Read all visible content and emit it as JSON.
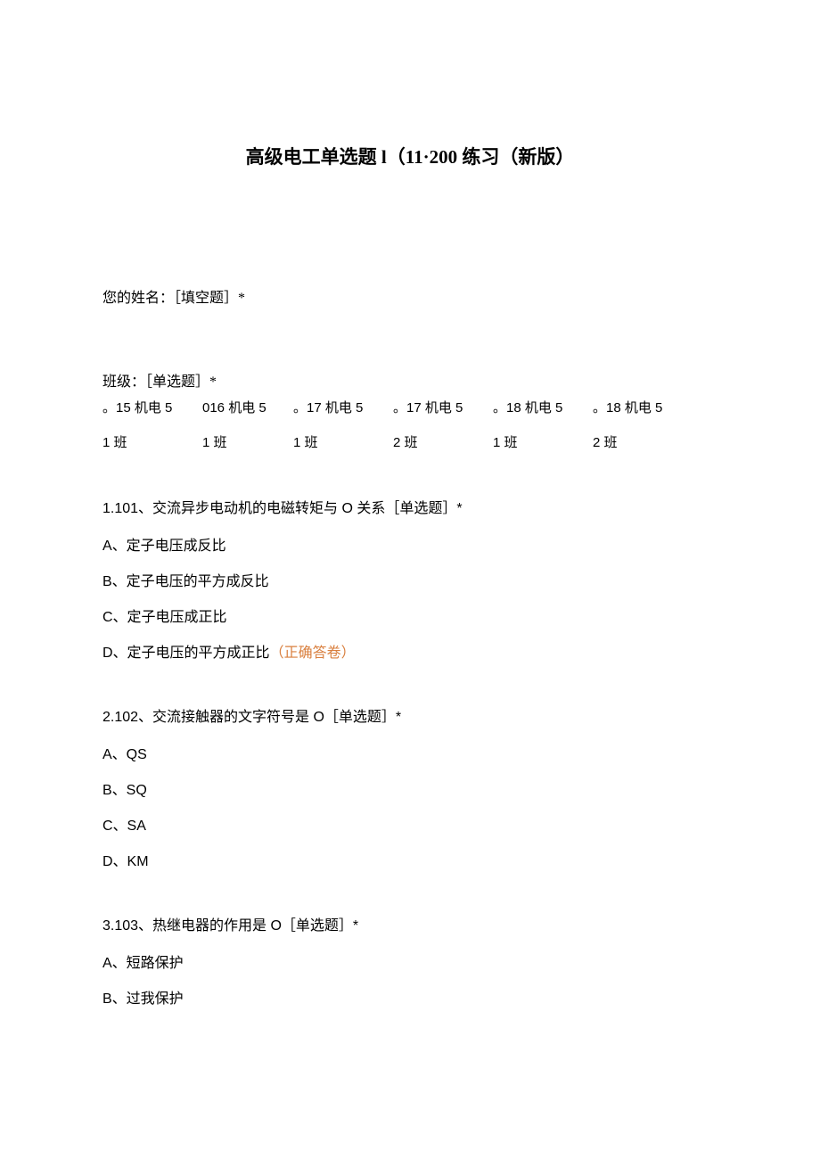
{
  "title": "高级电工单选题 l（11·200 练习（新版）",
  "name_label": "您的姓名：［填空题］*",
  "class_label": "班级：［单选题］*",
  "class_options": {
    "row1": [
      "。15 机电 5",
      "016 机电 5",
      "。17 机电 5",
      "。17 机电 5",
      "。18 机电 5",
      "。18 机电 5"
    ],
    "row2": [
      "1 班",
      "1 班",
      "1 班",
      "2 班",
      "1 班",
      "2 班"
    ]
  },
  "questions": [
    {
      "stem": "1.101、交流异步电动机的电磁转矩与 O 关系［单选题］*",
      "options": [
        {
          "text": "A、定子电压成反比",
          "correct": false
        },
        {
          "text": "B、定子电压的平方成反比",
          "correct": false
        },
        {
          "text": "C、定子电压成正比",
          "correct": false
        },
        {
          "text": "D、定子电压的平方成正比",
          "correct": true,
          "correct_label": "（正确答卷）"
        }
      ]
    },
    {
      "stem": "2.102、交流接触器的文字符号是 O［单选题］*",
      "options": [
        {
          "text": "A、QS",
          "correct": false
        },
        {
          "text": "B、SQ",
          "correct": false
        },
        {
          "text": "C、SA",
          "correct": false
        },
        {
          "text": "D、KM",
          "correct": false
        }
      ]
    },
    {
      "stem": "3.103、热继电器的作用是 O［单选题］*",
      "options": [
        {
          "text": "A、短路保护",
          "correct": false
        },
        {
          "text": "B、过我保护",
          "correct": false
        }
      ]
    }
  ]
}
